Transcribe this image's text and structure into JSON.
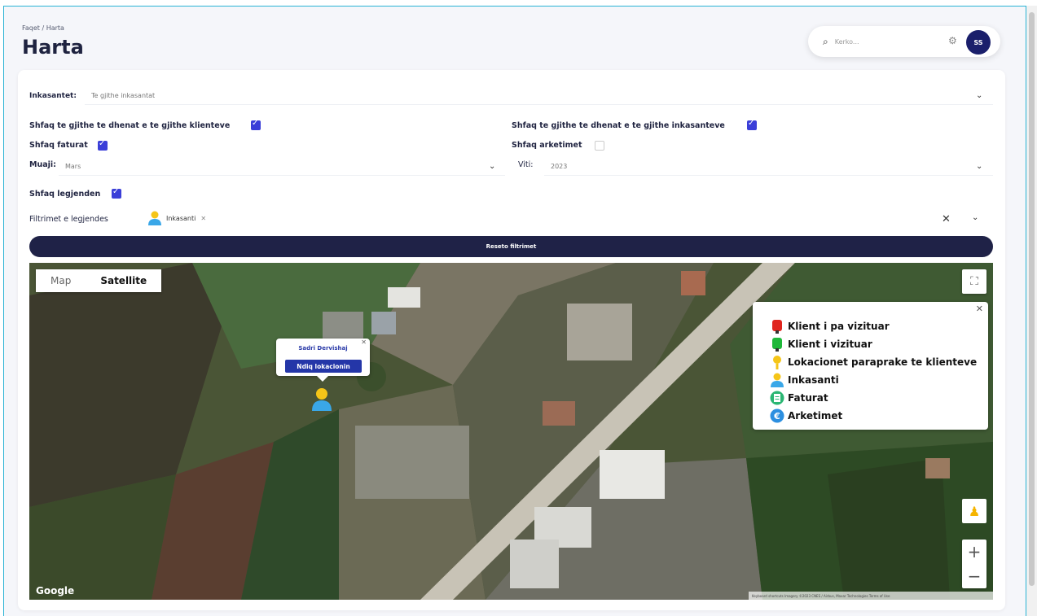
{
  "header": {
    "breadcrumb": "Faqet  /  Harta",
    "title": "Harta",
    "search_placeholder": "Kerko...",
    "avatar_initials": "SS"
  },
  "filters": {
    "inkasantet_label": "Inkasantet:",
    "inkasantet_value": "Te gjithe inkasantat",
    "show_all_clients_label": "Shfaq te gjithe te dhenat e te gjithe klienteve",
    "show_all_clients_checked": true,
    "show_all_inkasants_label": "Shfaq te gjithe te dhenat e te gjithe inkasanteve",
    "show_all_inkasants_checked": true,
    "show_invoices_label": "Shfaq faturat",
    "show_invoices_checked": true,
    "show_receipts_label": "Shfaq arketimet",
    "show_receipts_checked": false,
    "month_label": "Muaji:",
    "month_value": "Mars",
    "year_label": "Viti:",
    "year_value": "2023",
    "show_legend_label": "Shfaq legjenden",
    "show_legend_checked": true,
    "legend_filters_label": "Filtrimet e legjendes",
    "legend_filter_chip": "Inkasanti",
    "reset_button": "Reseto filtrimet"
  },
  "map": {
    "type_map": "Map",
    "type_satellite": "Satellite",
    "google_logo": "Google",
    "attribution": "Keyboard shortcuts   Imagery ©2023 CNES / Airbus, Maxar Technologies   Terms of Use",
    "popup_name": "Sadri Dervishaj",
    "popup_button": "Ndiq lokacionin",
    "legend": [
      {
        "label": "Klient i pa vizituar",
        "icon": "red-pin-icon"
      },
      {
        "label": "Klient i vizituar",
        "icon": "green-pin-icon"
      },
      {
        "label": "Lokacionet paraprake te klienteve",
        "icon": "yellow-pin-icon"
      },
      {
        "label": "Inkasanti",
        "icon": "person-icon"
      },
      {
        "label": "Faturat",
        "icon": "invoice-icon"
      },
      {
        "label": "Arketimet",
        "icon": "euro-icon"
      }
    ]
  }
}
